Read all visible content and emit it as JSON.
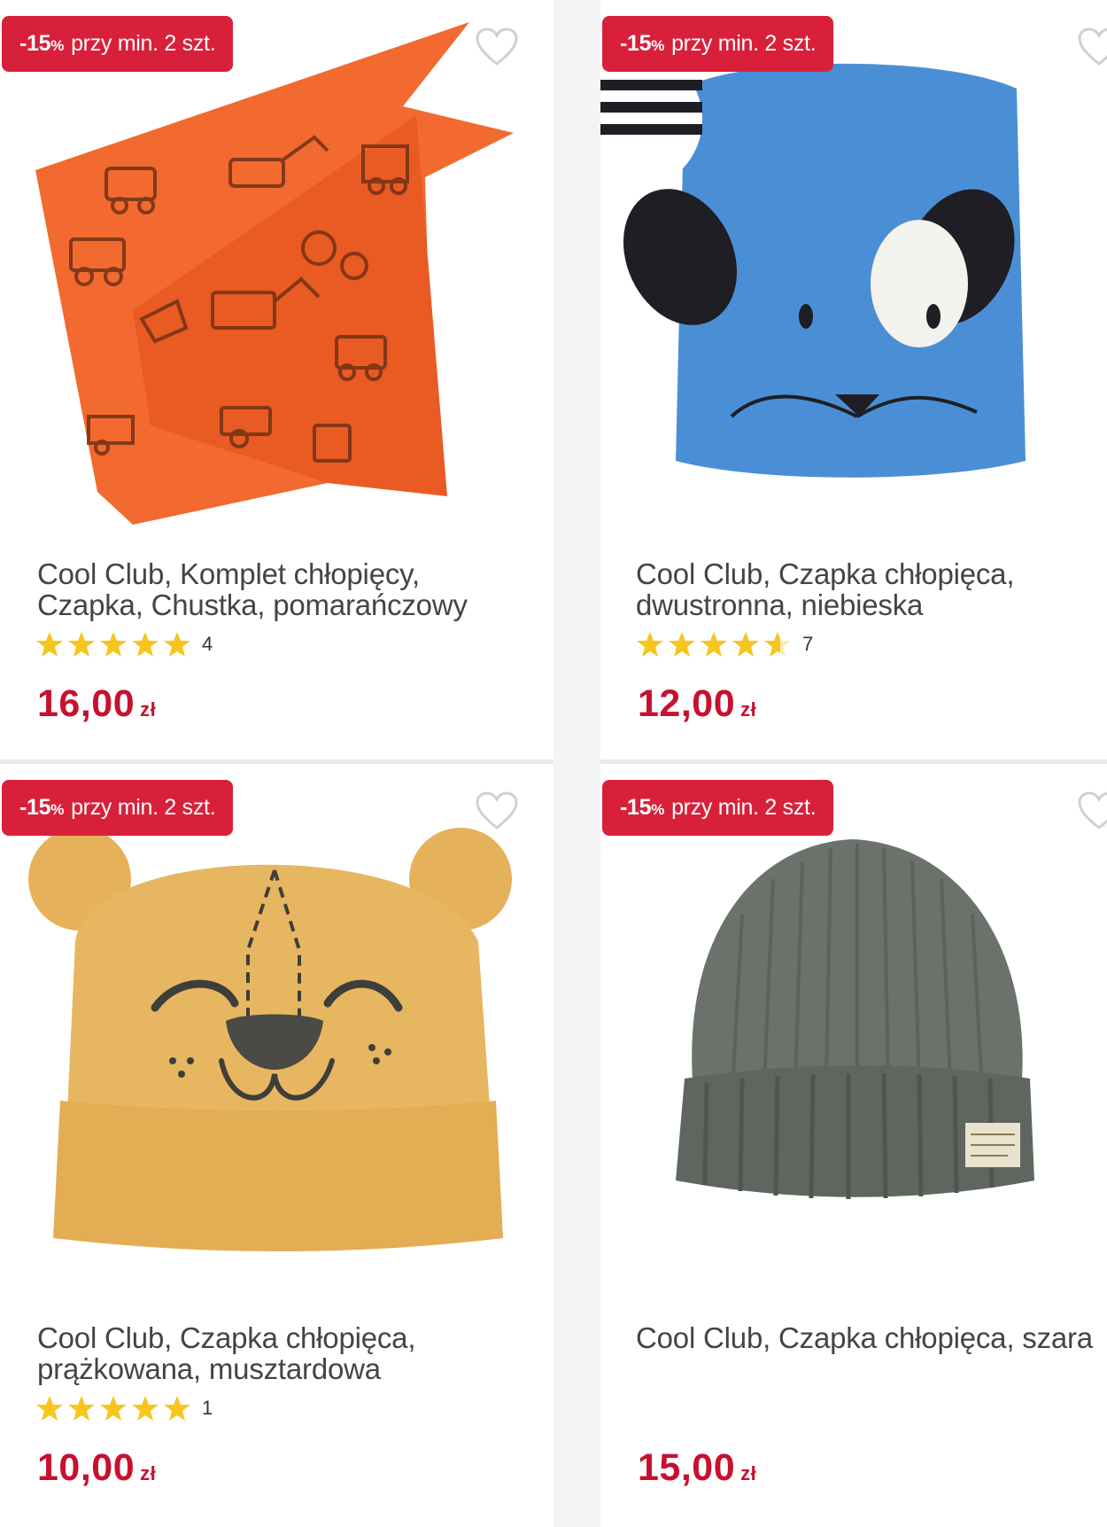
{
  "badge": {
    "percent": "-15",
    "percent_sign": "%",
    "text": "przy min. 2 szt."
  },
  "products": [
    {
      "title": "Cool Club, Komplet chłopięcy, Czapka, Chustka, pomarańczowy",
      "rating_count": "4",
      "rating": 5,
      "price": "16,00",
      "currency": "zł",
      "image": "orange-bandana-hat-image"
    },
    {
      "title": "Cool Club, Czapka chłopięca, dwustronna, niebieska",
      "rating_count": "7",
      "rating": 4.5,
      "price": "12,00",
      "currency": "zł",
      "image": "blue-dog-hat-image"
    },
    {
      "title": "Cool Club, Czapka chłopięca, prążkowana, musztardowa",
      "rating_count": "1",
      "rating": 5,
      "price": "10,00",
      "currency": "zł",
      "image": "mustard-bear-hat-image"
    },
    {
      "title": "Cool Club, Czapka chłopięca, szara",
      "price": "15,00",
      "currency": "zł",
      "image": "grey-knit-beanie-image"
    }
  ],
  "colors": {
    "accent": "#d8203a",
    "price": "#c8102e",
    "star": "#f7c51e"
  },
  "icons": {
    "favorite": "heart-outline-icon",
    "rating": "star-icon"
  }
}
